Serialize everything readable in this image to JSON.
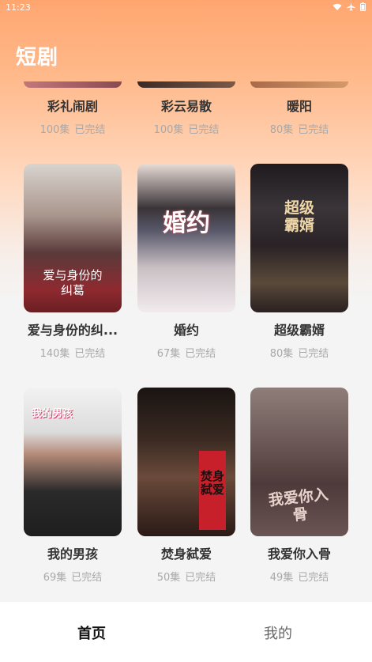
{
  "status_bar": {
    "time": "11:23"
  },
  "header": {
    "title": "短剧"
  },
  "partial_row": [
    {
      "name": "彩礼闹剧",
      "episodes": "100集",
      "status": "已完结"
    },
    {
      "name": "彩云易散",
      "episodes": "100集",
      "status": "已完结"
    },
    {
      "name": "暖阳",
      "episodes": "80集",
      "status": "已完结"
    }
  ],
  "dramas": [
    {
      "name": "爱与身份的纠...",
      "episodes": "140集",
      "status": "已完结",
      "cover_text": "爱与身份的纠葛"
    },
    {
      "name": "婚约",
      "episodes": "67集",
      "status": "已完结",
      "cover_text": "婚约"
    },
    {
      "name": "超级霸婿",
      "episodes": "80集",
      "status": "已完结",
      "cover_text": "超级霸婿"
    },
    {
      "name": "我的男孩",
      "episodes": "69集",
      "status": "已完结",
      "cover_text": "我的男孩"
    },
    {
      "name": "焚身弑爱",
      "episodes": "50集",
      "status": "已完结",
      "cover_text": "焚身弑爱"
    },
    {
      "name": "我爱你入骨",
      "episodes": "49集",
      "status": "已完结",
      "cover_text": "我爱你入骨"
    }
  ],
  "bottom_nav": {
    "home_label": "首页",
    "mine_label": "我的"
  }
}
